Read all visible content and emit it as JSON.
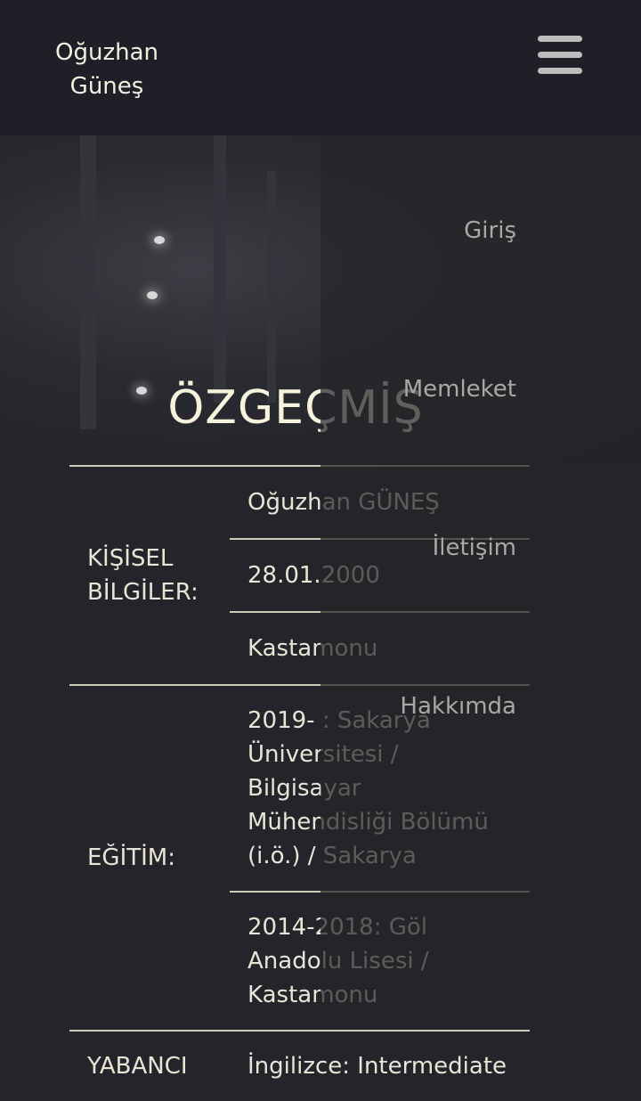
{
  "header": {
    "brand": "Oğuzhan Güneş",
    "menu_icon": "hamburger-menu-icon"
  },
  "page": {
    "title": "ÖZGEÇMİŞ"
  },
  "cv": {
    "sections": [
      {
        "label": "KİŞİSEL BİLGİLER:",
        "rows": [
          "Oğuzhan GÜNEŞ",
          "28.01.2000",
          "Kastamonu"
        ]
      },
      {
        "label": "EĞİTİM:",
        "rows": [
          "2019- : Sakarya Üniversitesi / Bilgisayar Mühendisliği Bölümü (i.ö.) / Sakarya",
          "2014-2018: Göl Anadolu Lisesi / Kastamonu"
        ]
      },
      {
        "label": "YABANCI",
        "rows": [
          "İngilizce: Intermediate"
        ]
      }
    ]
  },
  "nav": {
    "items": [
      "Giriş",
      "Memleket",
      "İletişim",
      "Hakkımda"
    ]
  },
  "colors": {
    "header_bg": "#1e1f27",
    "title": "#f7f2dc",
    "menu_text": "#a8a8a4"
  }
}
